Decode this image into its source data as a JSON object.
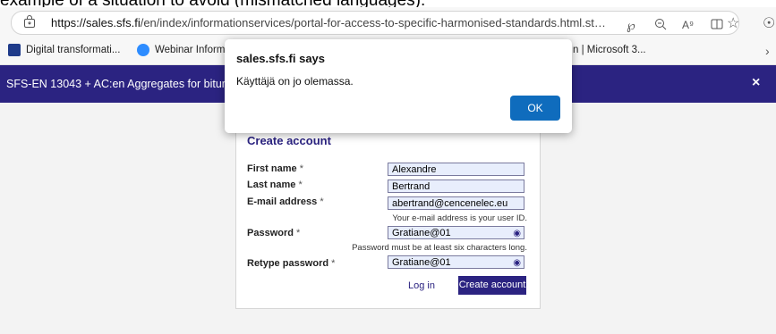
{
  "caption": {
    "text": "example of a situation to avoid (mismatched languages):"
  },
  "browser": {
    "url_host": "https://sales.sfs.fi",
    "url_path": "/en/index/informationservices/portal-for-access-to-specific-harmonised-standards.html.stx#?..."
  },
  "bookmarks": {
    "items": [
      {
        "label": "Digital transformati...",
        "icon": "iec-logo-icon",
        "color": "#1f3b8a"
      },
      {
        "label": "Webinar Informat",
        "icon": "zoom-logo-icon",
        "color": "#2d8cff"
      },
      {
        "label": "n | Microsoft 3...",
        "icon": "",
        "color": ""
      }
    ]
  },
  "banner": {
    "title": "SFS-EN 13043 + AC:en Aggregates for bituminou",
    "close": "×",
    "color": "#2b2381"
  },
  "form": {
    "title": "Create account",
    "first_name_label": "First name",
    "first_name_value": "Alexandre",
    "last_name_label": "Last name",
    "last_name_value": "Bertrand",
    "email_label": "E-mail address",
    "email_value": "abertrand@cencenelec.eu",
    "email_hint": "Your e-mail address is your user ID.",
    "password_label": "Password",
    "password_value": "Gratiane@01",
    "password_hint": "Password must be at least six characters long.",
    "retype_label": "Retype password",
    "retype_value": "Gratiane@01",
    "required_mark": "*",
    "login_link": "Log in",
    "create_button": "Create account"
  },
  "dialog": {
    "title": "sales.sfs.fi says",
    "message": "Käyttäjä on jo olemassa.",
    "ok_button": "OK",
    "ok_color": "#0f6cbd"
  }
}
